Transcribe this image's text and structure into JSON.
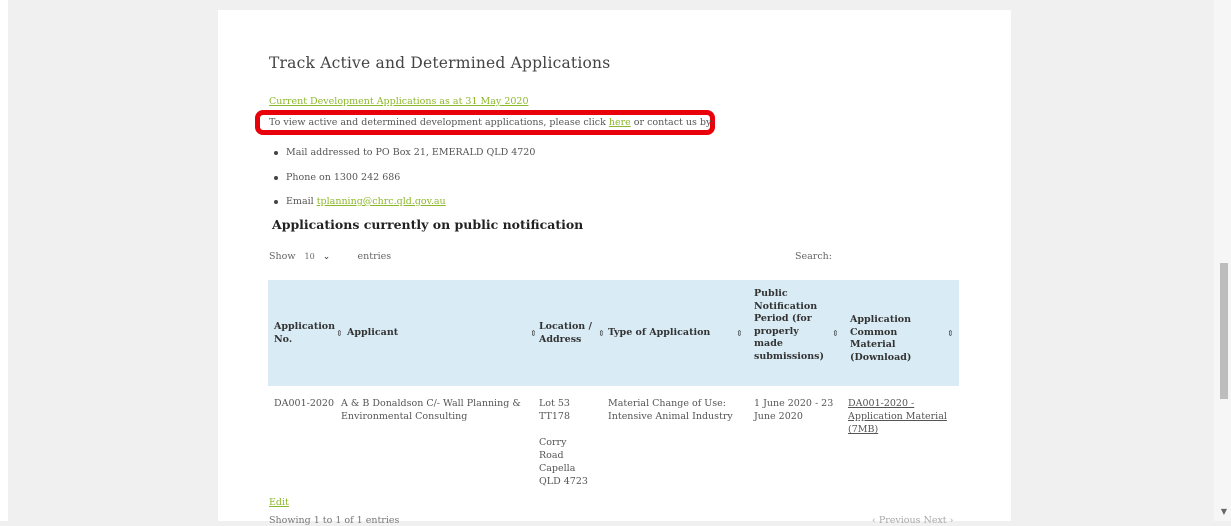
{
  "page": {
    "title": "Track Active and Determined Applications",
    "current_link": "Current Development Applications as at 31 May 2020",
    "view_text_before": "To view active and determined development applications, please click ",
    "view_link": "here",
    "view_text_after": " or contact us by:",
    "contacts": [
      {
        "text": "Mail addressed to PO Box 21, EMERALD QLD 4720"
      },
      {
        "text": "Phone on 1300 242 686"
      },
      {
        "text_prefix": "Email ",
        "link": "tplanning@chrc.qld.gov.au"
      }
    ],
    "section_heading": "Applications currently on public notification"
  },
  "table_controls": {
    "show_label": "Show",
    "entries_value": "10",
    "entries_label": "entries",
    "search_label": "Search:"
  },
  "table": {
    "headers": [
      "Application No.",
      "Applicant",
      "Location / Address",
      "Type of Application",
      "Public Notification Period (for properly made submissions)",
      "Application Common Material (Download)"
    ],
    "rows": [
      {
        "application_no": "DA001-2020",
        "applicant": "A & B Donaldson C/- Wall Planning & Environmental Consulting",
        "location": "Lot 53 TT178",
        "address": "Corry Road Capella QLD 4723",
        "type": "Material Change of Use: Intensive Animal Industry",
        "period": "1 June 2020 - 23 June 2020",
        "material": "DA001-2020 - Application Material (7MB)"
      }
    ]
  },
  "footer": {
    "edit_label": "Edit",
    "showing_text": "Showing 1 to 1 of 1 entries",
    "pager_text": "‹ Previous   Next ›"
  },
  "colors": {
    "link": "#8cb82b",
    "highlight": "#e8000b",
    "table_header_bg": "#d9ecf5"
  }
}
